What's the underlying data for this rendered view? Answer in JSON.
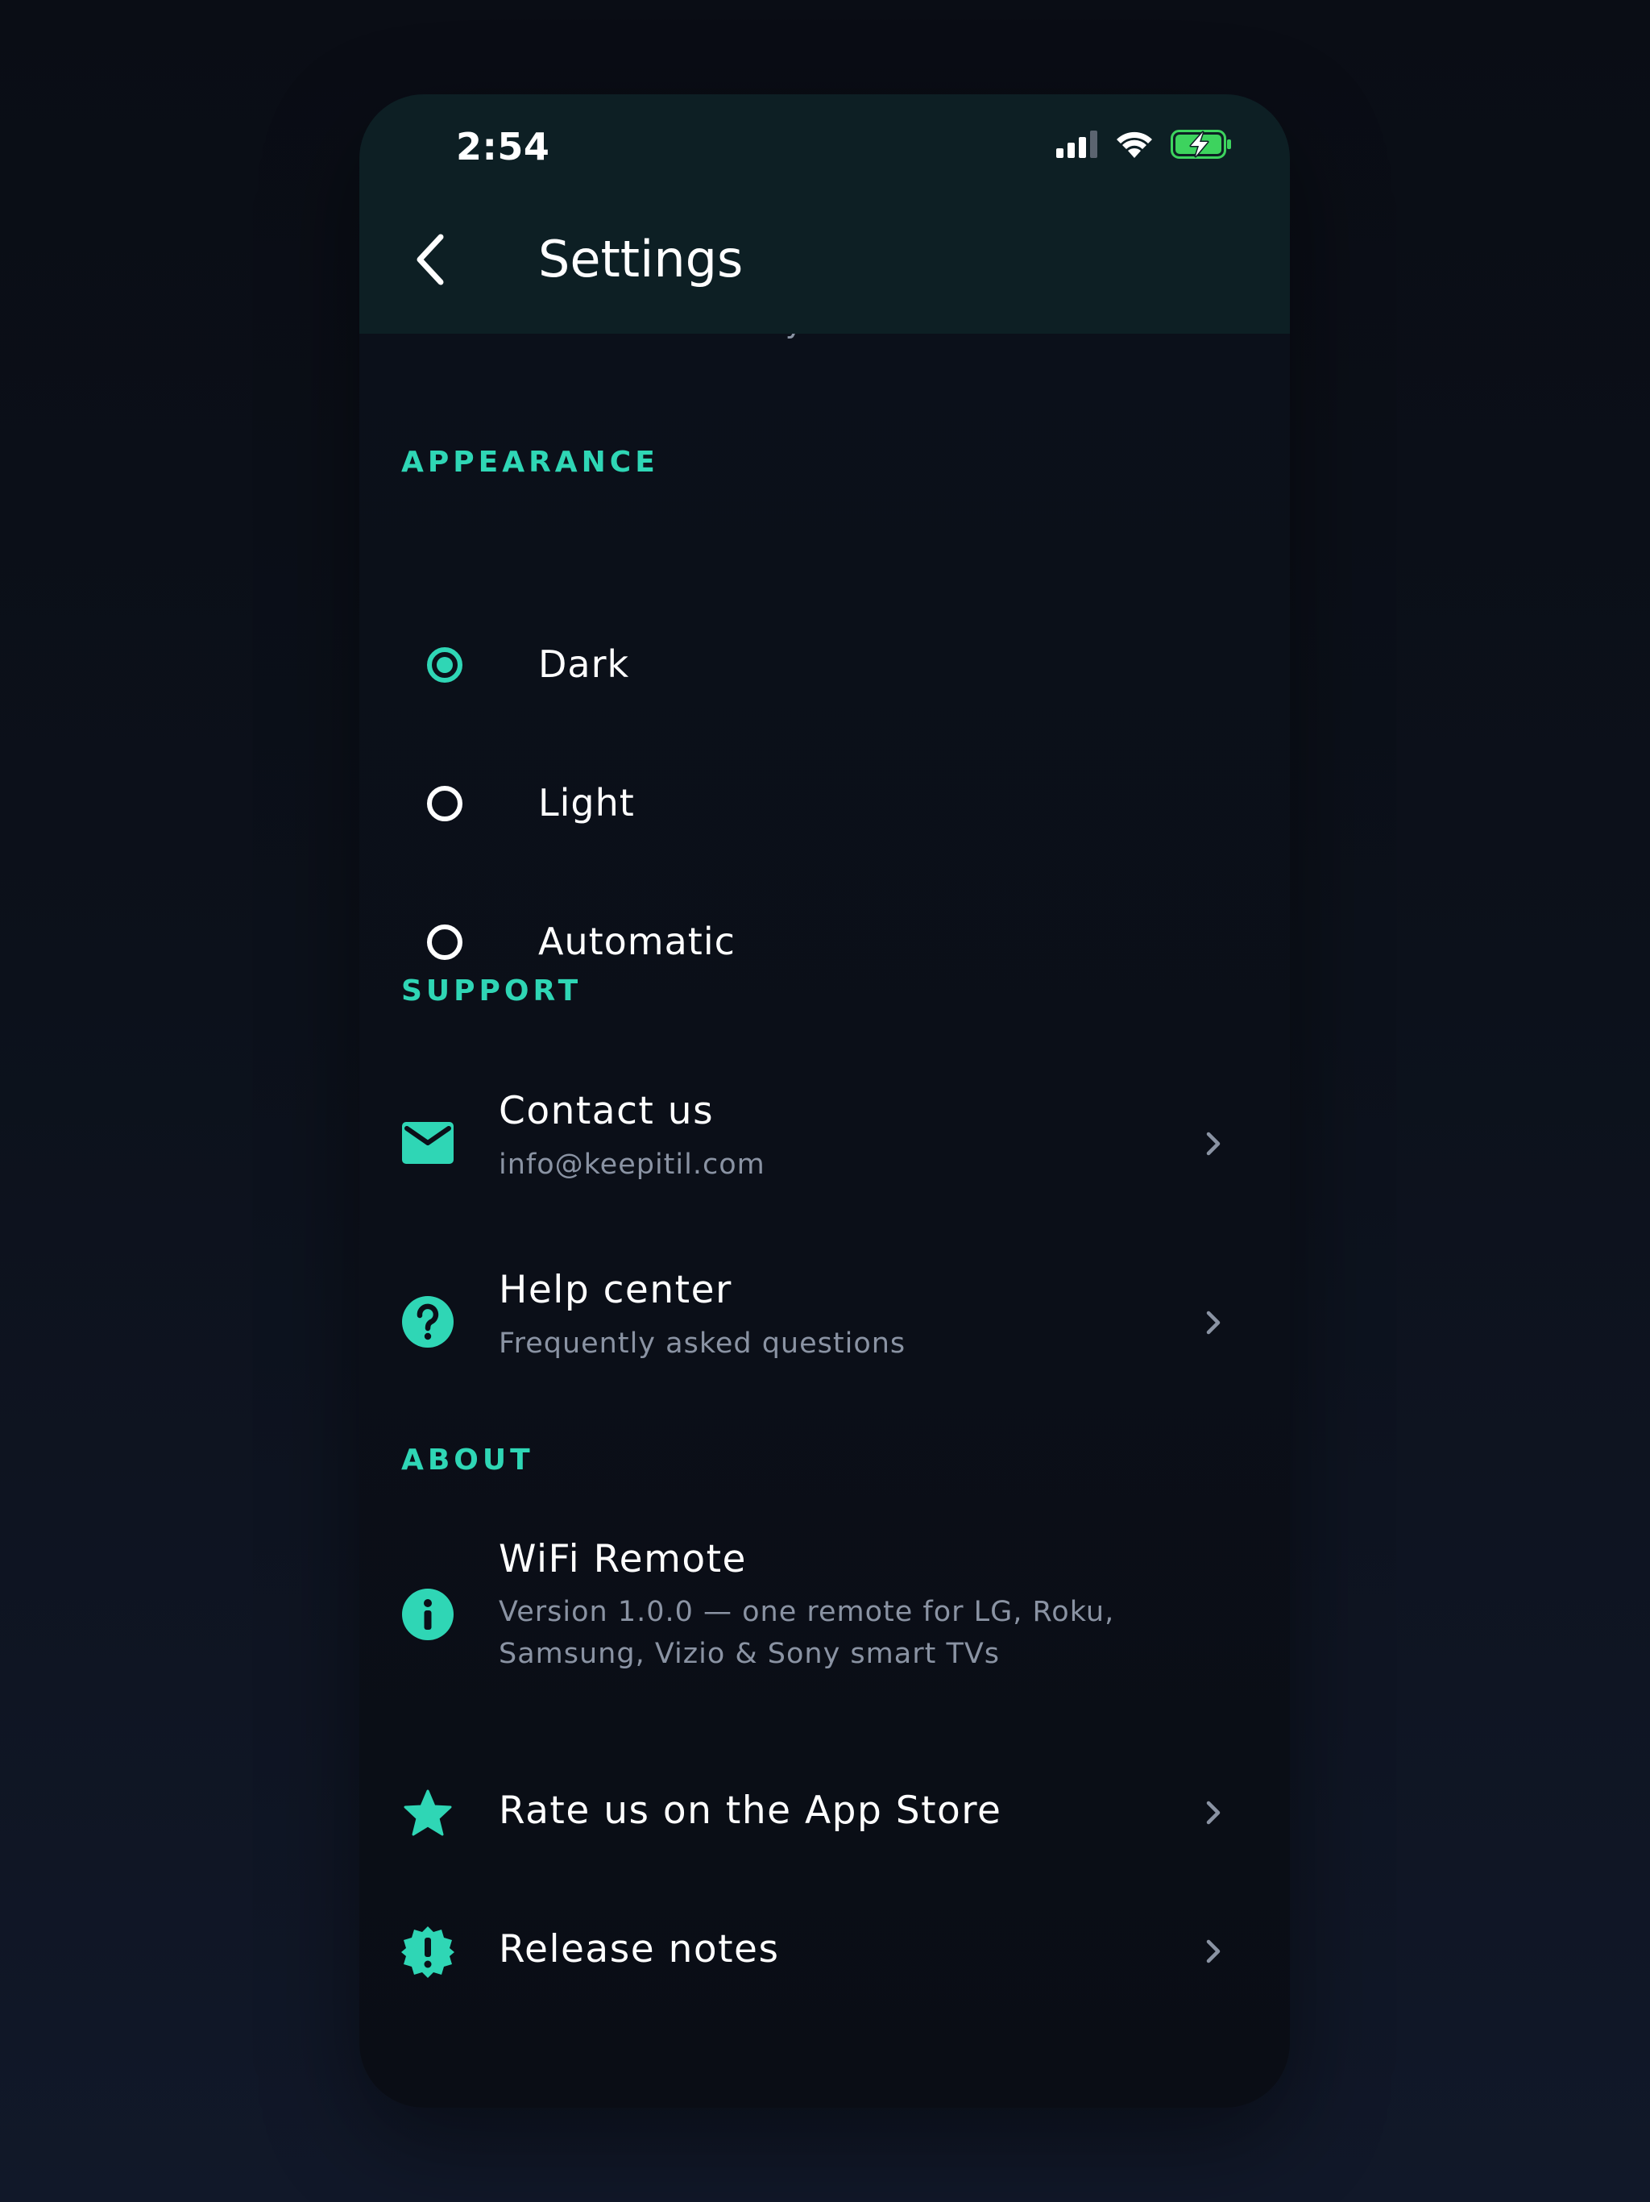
{
  "status_bar": {
    "time": "2:54"
  },
  "nav": {
    "title": "Settings"
  },
  "peek": {
    "text": "Auto-reconnect to your last TV"
  },
  "appearance": {
    "header": "APPEARANCE",
    "options": [
      {
        "label": "Dark",
        "selected": true
      },
      {
        "label": "Light",
        "selected": false
      },
      {
        "label": "Automatic",
        "selected": false
      }
    ]
  },
  "support": {
    "header": "SUPPORT",
    "contact": {
      "title": "Contact us",
      "subtitle": "info@keepitil.com",
      "icon": "mail-icon"
    },
    "help": {
      "title": "Help center",
      "subtitle": "Frequently asked questions",
      "icon": "help-icon"
    }
  },
  "about": {
    "header": "ABOUT",
    "app": {
      "title": "WiFi Remote",
      "subtitle_line1": "Version 1.0.0 — one remote for LG, Roku,",
      "subtitle_line2": "Samsung, Vizio & Sony smart TVs",
      "icon": "info-icon"
    },
    "rate": {
      "title": "Rate us on the App Store",
      "icon": "star-icon"
    },
    "release": {
      "title": "Release notes",
      "icon": "badge-alert-icon"
    }
  },
  "colors": {
    "accent": "#2fd6b5",
    "header_bg": "#0d1f24",
    "background": "#0b0f18",
    "secondary_text": "#8a93a3",
    "battery_green": "#3dd35e"
  }
}
